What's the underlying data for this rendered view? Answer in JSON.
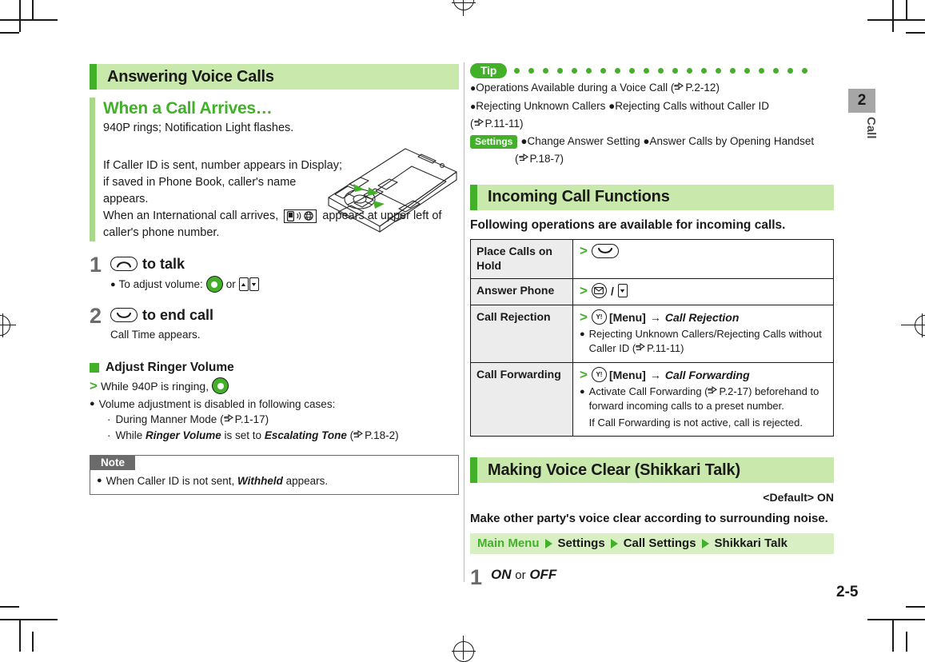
{
  "page": {
    "number": "2-5",
    "chapter_number": "2",
    "chapter_label": "Call",
    "accent_green": "#43b02a",
    "header_band": "#c9e8ab",
    "table_header_gray": "#ececec",
    "note_gray": "#6b6b6b"
  },
  "left": {
    "section_title": "Answering Voice Calls",
    "sub_title": "When a Call Arrives…",
    "intro_line1": "940P rings; Notification Light flashes.",
    "intro_line2": "If Caller ID is sent, number appears in Display; if saved in Phone Book, caller's name appears.",
    "intro_line3_a": "When an International call arrives,",
    "intro_line3_icon": "international-call-icon",
    "intro_line3_b": "appears at upper left of caller's phone number.",
    "steps": [
      {
        "num": "1",
        "key_icon": "send-call-key",
        "title": "to talk",
        "bullet_prefix": "To adjust volume:",
        "bullet_icon_1": "navigation-key",
        "bullet_or": "or",
        "bullet_icon_2": "side-up-down-keys"
      },
      {
        "num": "2",
        "key_icon": "end-call-key",
        "title": "to end call",
        "note": "Call Time appears."
      }
    ],
    "adjust": {
      "heading": "Adjust Ringer Volume",
      "action_text": "While 940P is ringing,",
      "action_icon": "navigation-key",
      "bullet": "Volume adjustment is disabled in following cases:",
      "cases": [
        {
          "text_before": "During Manner Mode (",
          "ref": "P.1-17",
          "text_after": ")"
        },
        {
          "text_before": "While ",
          "italic_1": "Ringer Volume",
          "mid": " is set to ",
          "italic_2": "Escalating Tone",
          "paren_open": " (",
          "ref": "P.18-2",
          "paren_close": ")"
        }
      ]
    },
    "note": {
      "tab": "Note",
      "text_before": "When Caller ID is not sent, ",
      "italic": "Withheld",
      "text_after": " appears."
    }
  },
  "right": {
    "tip": {
      "badge": "Tip",
      "dot_count": 21,
      "lines": [
        {
          "bullet": true,
          "text": "Operations Available during a Voice Call (",
          "ref": "P.2-12",
          "after": ")"
        },
        {
          "bullet": true,
          "text": "Rejecting Unknown Callers ●Rejecting Calls without Caller ID"
        },
        {
          "bullet": false,
          "text": "(",
          "ref": "P.11-11",
          "after": ")"
        }
      ],
      "settings_badge": "Settings",
      "settings_text": "●Change Answer Setting ●Answer Calls by Opening Handset",
      "settings_ref_open": "(",
      "settings_ref": "P.18-7",
      "settings_ref_close": ")"
    },
    "incoming": {
      "section_title": "Incoming Call Functions",
      "lead": "Following operations are available for incoming calls.",
      "rows": [
        {
          "label": "Place Calls on Hold",
          "action_icons": [
            "end-call-key"
          ],
          "action_text": "",
          "sub": []
        },
        {
          "label": "Answer Phone",
          "action_icons": [
            "mail-key",
            "slash",
            "side-down-key"
          ],
          "action_text": "",
          "sub": []
        },
        {
          "label": "Call Rejection",
          "action_icons": [
            "yahoo-menu-key"
          ],
          "action_text": "[Menu]",
          "action_arrow": "→",
          "action_italic": "Call Rejection",
          "sub": [
            {
              "text_before": "Rejecting Unknown Callers/Rejecting Calls without Caller ID (",
              "ref": "P.11-11",
              "text_after": ")"
            }
          ]
        },
        {
          "label": "Call Forwarding",
          "action_icons": [
            "yahoo-menu-key"
          ],
          "action_text": "[Menu]",
          "action_arrow": "→",
          "action_italic": "Call Forwarding",
          "sub": [
            {
              "text_before": "Activate Call Forwarding (",
              "ref": "P.2-17",
              "text_after": ") beforehand to forward incoming calls to a preset number."
            },
            {
              "plain": "If Call Forwarding is not active, call is rejected."
            }
          ]
        }
      ]
    },
    "shikkari": {
      "section_title": "Making Voice Clear (Shikkari Talk)",
      "default": "<Default> ON",
      "description": "Make other party's voice clear according to surrounding noise.",
      "menu_path": [
        "Main Menu",
        "Settings",
        "Call Settings",
        "Shikkari Talk"
      ],
      "step_num": "1",
      "step_option_1": "ON",
      "step_or": "or",
      "step_option_2": "OFF"
    }
  }
}
